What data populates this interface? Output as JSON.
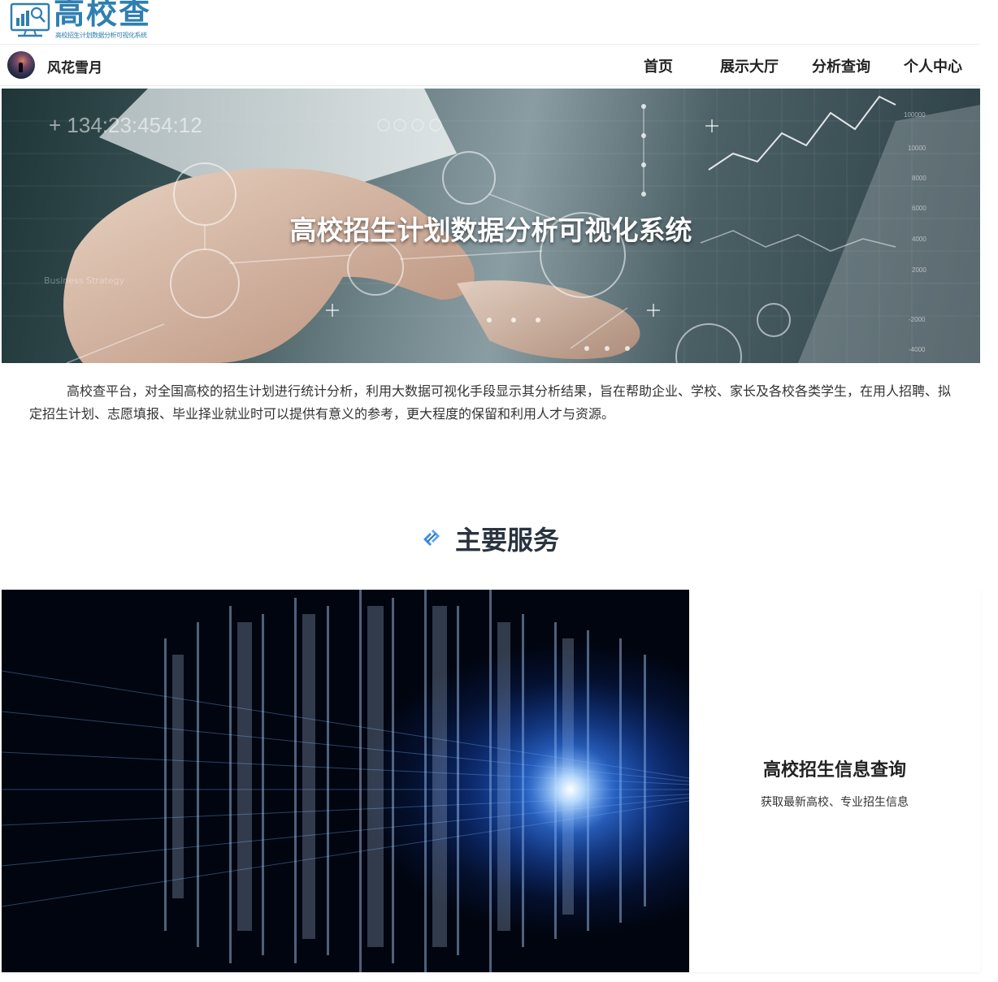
{
  "brand": {
    "title": "高校查",
    "subtitle": "高校招生计划数据分析可视化系统",
    "accent_color": "#2f7fb0",
    "logo_icon": "monitor-chart-magnifier-icon"
  },
  "nav": {
    "user_name": "风花雪月",
    "avatar_icon": "avatar",
    "items": [
      {
        "label": "首页"
      },
      {
        "label": "展示大厅"
      },
      {
        "label": "分析查询"
      },
      {
        "label": "个人中心"
      }
    ]
  },
  "hero": {
    "title": "高校招生计划数据分析可视化系统",
    "counter": "+ 134:23:454:12",
    "tag": "Business Strategy"
  },
  "intro": {
    "text": "高校查平台，对全国高校的招生计划进行统计分析，利用大数据可视化手段显示其分析结果，旨在帮助企业、学校、家长及各校各类学生，在用人招聘、拟定招生计划、志愿填报、毕业择业就业时可以提供有意义的参考，更大程度的保留和利用人才与资源。"
  },
  "services": {
    "heading": "主要服务",
    "heading_icon": "link-arrows-icon",
    "cards": [
      {
        "title": "高校招生信息查询",
        "description": "获取最新高校、专业招生信息"
      }
    ]
  }
}
